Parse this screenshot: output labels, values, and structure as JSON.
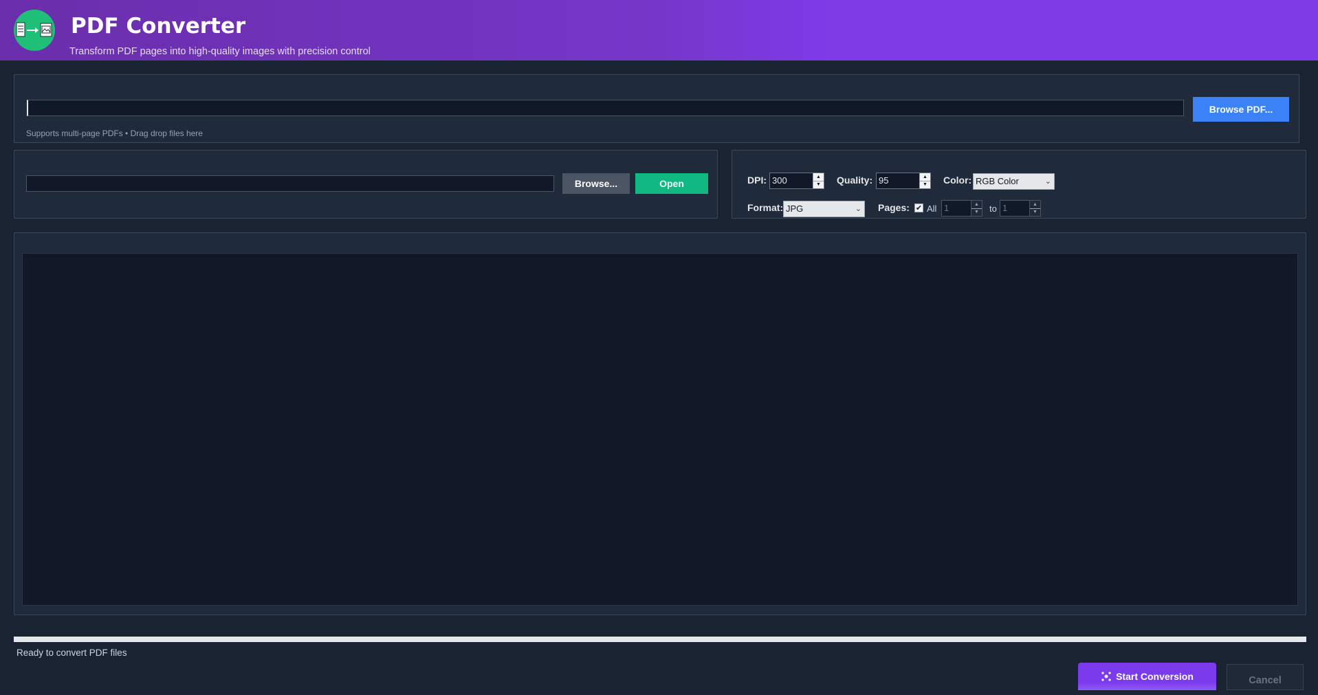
{
  "header": {
    "title": "PDF Converter",
    "subtitle": "Transform PDF pages into high-quality images with precision control",
    "logo_icon": "pdf-to-image-icon"
  },
  "source": {
    "pdf_path_value": "",
    "browse_pdf_label": "Browse PDF...",
    "hint": "Supports multi-page PDFs • Drag  drop files here"
  },
  "output": {
    "folder_path_value": "",
    "browse_label": "Browse...",
    "open_label": "Open"
  },
  "settings": {
    "dpi_label": "DPI:",
    "dpi_value": "300",
    "quality_label": "Quality:",
    "quality_value": "95",
    "color_label": "Color:",
    "color_value": "RGB Color",
    "format_label": "Format:",
    "format_value": "JPG",
    "pages_label": "Pages:",
    "all_label": "All",
    "all_checked": true,
    "from_value": "1",
    "to_label": "to",
    "to_value": "1"
  },
  "status": {
    "text": "Ready to convert PDF files",
    "progress": 0
  },
  "actions": {
    "start_label": "Start Conversion",
    "cancel_label": "Cancel"
  },
  "colors": {
    "accent_purple": "#7c3aed",
    "accent_blue": "#3b82f6",
    "accent_green": "#10b981",
    "background": "#1a2332"
  }
}
